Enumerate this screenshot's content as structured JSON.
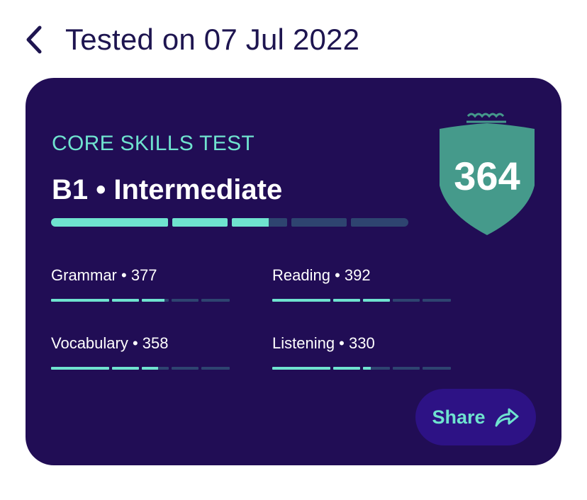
{
  "header": {
    "title": "Tested on 07 Jul 2022",
    "back_icon": "chevron-left-icon"
  },
  "card": {
    "test_name": "CORE SKILLS TEST",
    "level": "B1 • Intermediate",
    "overall_score": "364",
    "overall_progress_segments": [
      1.0,
      1.0,
      0.67,
      0.0,
      0.0
    ],
    "badge_icon": "shield-crown-icon",
    "skills": [
      {
        "name": "Grammar",
        "score": "377",
        "label": "Grammar • 377",
        "segments": [
          1.0,
          1.0,
          0.85,
          0.0,
          0.0
        ]
      },
      {
        "name": "Reading",
        "score": "392",
        "label": "Reading • 392",
        "segments": [
          1.0,
          1.0,
          1.0,
          0.0,
          0.0
        ]
      },
      {
        "name": "Vocabulary",
        "score": "358",
        "label": "Vocabulary • 358",
        "segments": [
          1.0,
          1.0,
          0.6,
          0.0,
          0.0
        ]
      },
      {
        "name": "Listening",
        "score": "330",
        "label": "Listening • 330",
        "segments": [
          1.0,
          1.0,
          0.3,
          0.0,
          0.0
        ]
      }
    ],
    "share": {
      "label": "Share",
      "icon": "share-arrow-icon"
    }
  },
  "colors": {
    "card_bg": "#210d55",
    "accent": "#6fe3cf",
    "track": "#2e4470",
    "shield": "#459a8b",
    "share_bg": "#2d1285",
    "title_text": "#1e1550"
  }
}
